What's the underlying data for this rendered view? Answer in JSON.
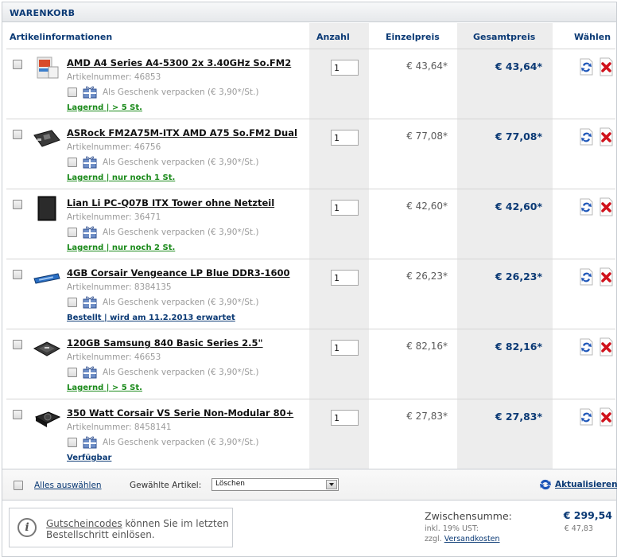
{
  "header": {
    "title": "WARENKORB"
  },
  "columns": {
    "info": "Artikelinformationen",
    "qty": "Anzahl",
    "unit_price": "Einzelpreis",
    "total_price": "Gesamtpreis",
    "choose": "Wählen"
  },
  "items": [
    {
      "title": "AMD A4 Series A4-5300 2x 3.40GHz So.FM2",
      "artnr": "Artikelnummer: 46853",
      "gift": "Als Geschenk verpacken (€ 3,90*/St.)",
      "stock": "Lagernd | > 5 St.",
      "stock_color": "#1a8a1a",
      "qty": "1",
      "unit_price": "€ 43,64*",
      "total_price": "€ 43,64*",
      "thumb": "cpu-box-icon"
    },
    {
      "title": "ASRock FM2A75M-ITX AMD A75 So.FM2 Dual",
      "artnr": "Artikelnummer: 46756",
      "gift": "Als Geschenk verpacken (€ 3,90*/St.)",
      "stock": "Lagernd | nur noch 1 St.",
      "stock_color": "#1a8a1a",
      "qty": "1",
      "unit_price": "€ 77,08*",
      "total_price": "€ 77,08*",
      "thumb": "motherboard-icon"
    },
    {
      "title": "Lian Li PC-Q07B ITX Tower ohne Netzteil",
      "artnr": "Artikelnummer: 36471",
      "gift": "Als Geschenk verpacken (€ 3,90*/St.)",
      "stock": "Lagernd | nur noch 2 St.",
      "stock_color": "#1a8a1a",
      "qty": "1",
      "unit_price": "€ 42,60*",
      "total_price": "€ 42,60*",
      "thumb": "pc-case-icon"
    },
    {
      "title": "4GB Corsair Vengeance LP Blue DDR3-1600",
      "artnr": "Artikelnummer: 8384135",
      "gift": "Als Geschenk verpacken (€ 3,90*/St.)",
      "stock": "Bestellt | wird am 11.2.2013 erwartet",
      "stock_color": "#0b3a75",
      "qty": "1",
      "unit_price": "€ 26,23*",
      "total_price": "€ 26,23*",
      "thumb": "ram-module-icon"
    },
    {
      "title": "120GB Samsung 840 Basic Series 2.5\"",
      "artnr": "Artikelnummer: 46653",
      "gift": "Als Geschenk verpacken (€ 3,90*/St.)",
      "stock": "Lagernd | > 5 St.",
      "stock_color": "#1a8a1a",
      "qty": "1",
      "unit_price": "€ 82,16*",
      "total_price": "€ 82,16*",
      "thumb": "ssd-icon"
    },
    {
      "title": "350 Watt Corsair VS Serie Non-Modular 80+",
      "artnr": "Artikelnummer: 8458141",
      "gift": "Als Geschenk verpacken (€ 3,90*/St.)",
      "stock": "Verfügbar",
      "stock_color": "#0b3a75",
      "qty": "1",
      "unit_price": "€ 27,83*",
      "total_price": "€ 27,83*",
      "thumb": "psu-icon"
    }
  ],
  "footer": {
    "select_all": "Alles auswählen",
    "chosen_label": "Gewählte Artikel:",
    "action_selected": "Löschen",
    "update": "Aktualisieren"
  },
  "coupon": {
    "link": "Gutscheincodes",
    "text": " können Sie im letzten Bestellschritt einlösen."
  },
  "summary": {
    "subtotal_label": "Zwischensumme:",
    "subtotal_value": "€ 299,54",
    "vat_label": "inkl. 19% UST:",
    "vat_value": "€ 47,83",
    "shipping_prefix": "zzgl. ",
    "shipping_link": "Versandkosten"
  },
  "colors": {
    "accent": "#0b3a75",
    "in_stock": "#1a8a1a",
    "delete": "#d0121b"
  }
}
